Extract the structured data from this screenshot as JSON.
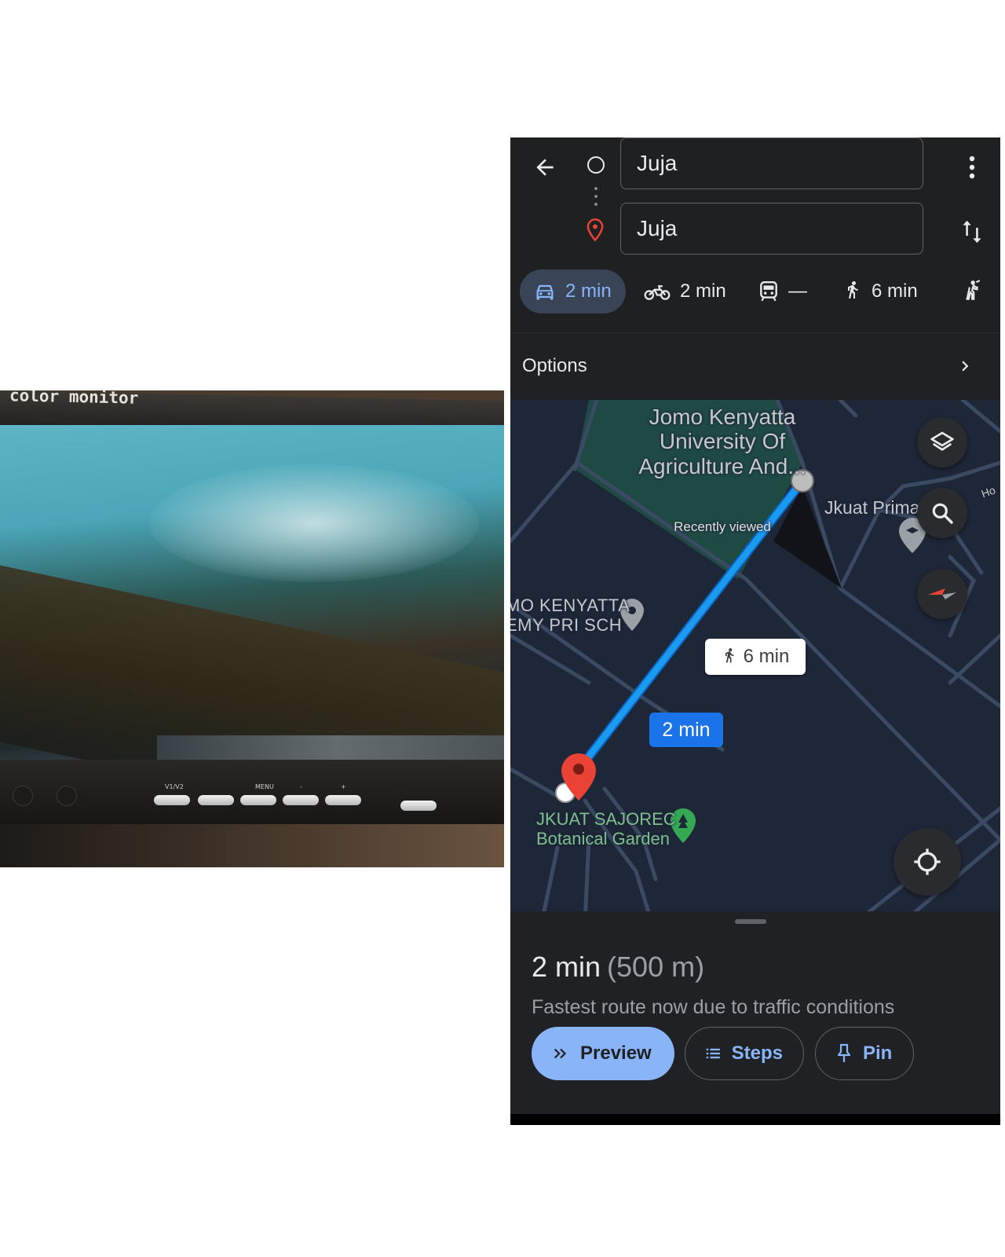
{
  "photo": {
    "brand_text": "color monitor",
    "buttons": [
      "V1/V2",
      "",
      "MENU",
      "-",
      "+"
    ]
  },
  "header": {
    "origin_value": "Juja",
    "destination_value": "Juja",
    "back_icon": "arrow-left-icon",
    "more_icon": "more-vertical-icon",
    "swap_icon": "swap-vertical-icon"
  },
  "modes": [
    {
      "icon": "car-icon",
      "label": "2 min",
      "active": true
    },
    {
      "icon": "motorcycle-icon",
      "label": "2 min"
    },
    {
      "icon": "transit-icon",
      "label": "—"
    },
    {
      "icon": "walk-icon",
      "label": "6 min"
    },
    {
      "icon": "ride-icon",
      "label": ""
    }
  ],
  "options": {
    "label": "Options"
  },
  "map": {
    "place_jkuat": "Jomo Kenyatta University Of Agriculture And...",
    "recently_viewed": "Recently viewed",
    "place_prima": "Jkuat Prima",
    "place_ho": "Ho",
    "place_school_line1": "MO KENYATTA",
    "place_school_line2": "EMY PRI SCH",
    "place_garden_line1": "JKUAT SAJOREC",
    "place_garden_line2": "Botanical Garden",
    "walk_chip": "6 min",
    "drive_chip": "2 min",
    "route_color": "#1a9bf0"
  },
  "sheet": {
    "duration": "2 min",
    "distance": "(500 m)",
    "reason": "Fastest route now due to traffic conditions",
    "preview_label": "Preview",
    "steps_label": "Steps",
    "pin_label": "Pin"
  },
  "colors": {
    "accent": "#8ab4f8",
    "surface": "#202124",
    "map_bg": "#1e2738",
    "pin_red": "#ea4335"
  }
}
